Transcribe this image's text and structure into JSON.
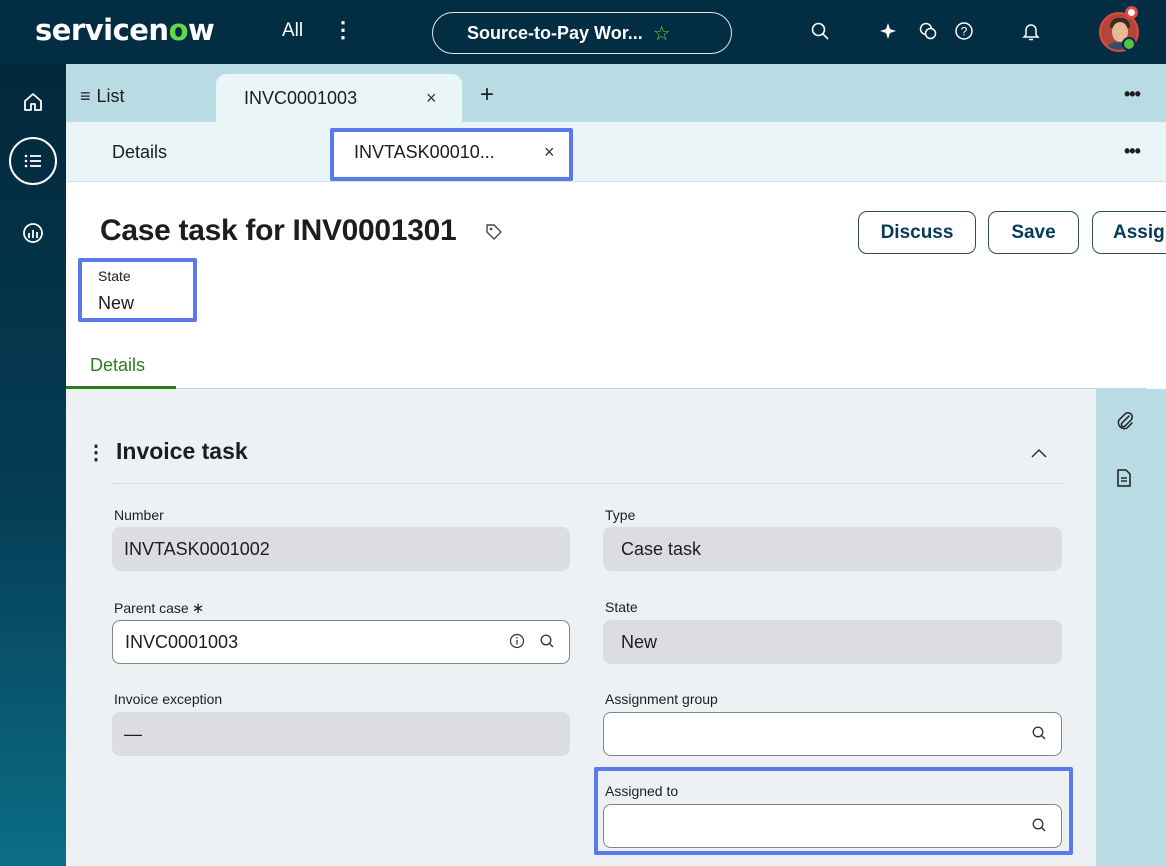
{
  "app": {
    "logo_text": "servicen",
    "logo_o": "o",
    "logo_end": "w",
    "all_menu": "All",
    "scope": "Source-to-Pay Wor...",
    "colors": {
      "topbar": "#032d42",
      "accent_green": "#62d84e",
      "highlight": "#5a79ea"
    }
  },
  "nav": {
    "items": [
      "home-icon",
      "list-icon",
      "analytics-icon"
    ]
  },
  "tabs": {
    "list_label": "List",
    "record_tab": "INVC0001003",
    "sub_details": "Details",
    "sub_task_tab": "INVTASK00010..."
  },
  "header": {
    "title": "Case task for INV0001301",
    "buttons": {
      "discuss": "Discuss",
      "save": "Save",
      "assign": "Assig"
    },
    "state_label": "State",
    "state_value": "New"
  },
  "form_tabs": {
    "details": "Details"
  },
  "section": {
    "title": "Invoice task",
    "fields": {
      "number": {
        "label": "Number",
        "value": "INVTASK0001002"
      },
      "type": {
        "label": "Type",
        "value": "Case task"
      },
      "parent_case": {
        "label": "Parent case",
        "required_mark": "∗",
        "value": "INVC0001003"
      },
      "state": {
        "label": "State",
        "value": "New"
      },
      "invoice_exception": {
        "label": "Invoice exception",
        "value": "—"
      },
      "assignment_group": {
        "label": "Assignment group",
        "value": ""
      },
      "assigned_to": {
        "label": "Assigned to",
        "value": ""
      }
    }
  }
}
